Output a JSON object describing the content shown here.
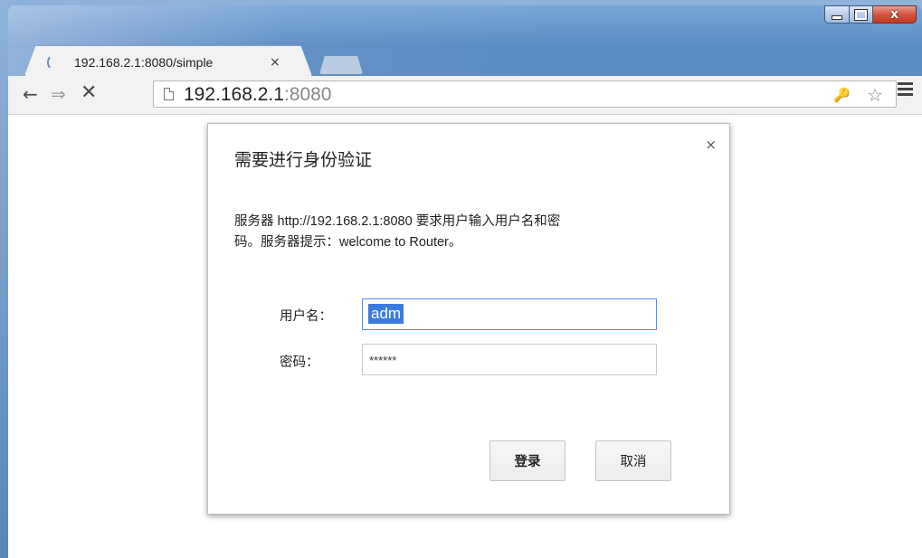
{
  "window": {
    "controls": {
      "minimize": "",
      "maximize": "",
      "close": "x"
    }
  },
  "tab": {
    "title": "192.168.2.1:8080/simple",
    "close": "×"
  },
  "toolbar": {
    "back": "←",
    "forward": "⇒",
    "stop": "✕",
    "url_host": "192.168.2.1",
    "url_port": ":8080",
    "key": "🔑",
    "star": "☆"
  },
  "dialog": {
    "close": "×",
    "title": "需要进行身份验证",
    "message_line1": "服务器 http://192.168.2.1:8080 要求用户输入用户名和密",
    "message_line2": "码。服务器提示：welcome to Router。",
    "username_label": "用户名：",
    "username_value": "adm",
    "password_label": "密码：",
    "password_value": "******",
    "login_button": "登录",
    "cancel_button": "取消"
  },
  "icons": {
    "loading": "spinner-icon",
    "page": "page-icon",
    "key": "key-icon",
    "star": "star-icon",
    "menu": "hamburger-menu-icon"
  }
}
